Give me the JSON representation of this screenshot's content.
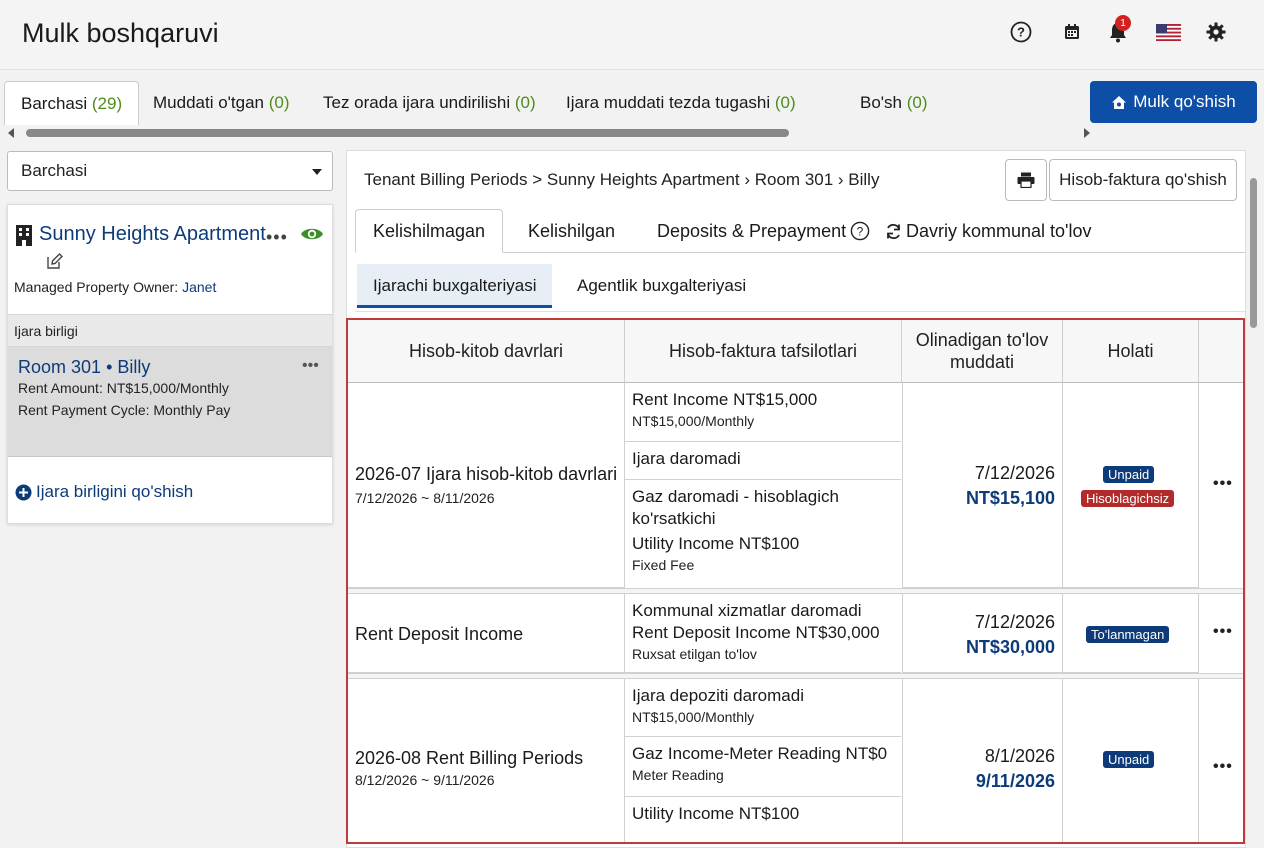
{
  "app": {
    "title": "Mulk boshqaruvi"
  },
  "header": {
    "notification_count": "1"
  },
  "top_tabs": [
    {
      "label": "Barchasi",
      "count": "(29)"
    },
    {
      "label": "Muddati o'tgan",
      "count": "(0)"
    },
    {
      "label": "Tez orada ijara undirilishi",
      "count": "(0)"
    },
    {
      "label": "Ijara muddati tezda tugashi",
      "count": "(0)"
    },
    {
      "label": "Bo'sh",
      "count": "(0)"
    }
  ],
  "add_property_button": "Mulk qo'shish",
  "filter": {
    "selected": "Barchasi"
  },
  "property": {
    "name": "Sunny Heights Apartment",
    "more": "•••",
    "owner_label": "Managed Property Owner: ",
    "owner_name": "Janet"
  },
  "rental_units": {
    "header": "Ijara birligi",
    "items": [
      {
        "room": "Room 301",
        "sep": " • ",
        "tenant": "Billy",
        "more": "•••",
        "rent_amount": "Rent Amount: NT$15,000/Monthly",
        "payment_cycle": "Rent Payment Cycle: Monthly Pay"
      }
    ],
    "add_label": "Ijara birligini qo'shish"
  },
  "breadcrumb": "Tenant Billing Periods >  Sunny Heights Apartment › Room 301 › Billy",
  "add_invoice_button": "Hisob-faktura qo'shish",
  "tabs": [
    {
      "label": "Kelishilmagan"
    },
    {
      "label": "Kelishilgan"
    },
    {
      "label": "Deposits & Prepayment"
    },
    {
      "label": "Davriy kommunal to'lov"
    }
  ],
  "subtabs": [
    {
      "label": "Ijarachi buxgalteriyasi"
    },
    {
      "label": "Agentlik buxgalteriyasi"
    }
  ],
  "table": {
    "headers": {
      "period": "Hisob-kitob davrlari",
      "details": "Hisob-faktura tafsilotlari",
      "due": "Olinadigan to'lov muddati",
      "status": "Holati"
    },
    "rows": [
      {
        "period_title": "2026-07 Ijara hisob-kitob davrlari",
        "period_range": "7/12/2026 ~ 8/11/2026",
        "details": [
          {
            "main": "Rent Income  NT$15,000",
            "sub": "NT$15,000/Monthly"
          },
          {
            "main": "Ijara daromadi",
            "sub": ""
          },
          {
            "main": "Gaz daromadi - hisoblagich ko'rsatkichi",
            "main2": "Utility Income  NT$100",
            "sub": "Fixed Fee"
          }
        ],
        "due_date": "7/12/2026",
        "due_amount": "NT$15,100",
        "status": [
          "Unpaid",
          "Hisoblagichsiz"
        ],
        "more": "•••"
      },
      {
        "period_title": "Rent Deposit Income",
        "period_range": "",
        "details": [
          {
            "main": "Kommunal xizmatlar daromadi",
            "main2": "Rent Deposit Income  NT$30,000",
            "sub": "Ruxsat etilgan to'lov"
          }
        ],
        "due_date": "7/12/2026",
        "due_amount": "NT$30,000",
        "status": [
          "To'lanmagan"
        ],
        "more": "•••"
      },
      {
        "period_title": "2026-08 Rent Billing Periods",
        "period_range": "8/12/2026 ~ 9/11/2026",
        "details": [
          {
            "main": "Ijara depoziti daromadi",
            "sub": "NT$15,000/Monthly"
          },
          {
            "main": "Gaz Income-Meter Reading  NT$0",
            "sub": "Meter Reading"
          },
          {
            "main": "Utility Income  NT$100",
            "sub": ""
          }
        ],
        "due_date": "8/1/2026",
        "due_amount": "9/11/2026",
        "status": [
          "Unpaid"
        ],
        "more": "•••"
      }
    ]
  },
  "colors": {
    "primary": "#0d4ea6",
    "link": "#0d3b79",
    "count_green": "#4e8d1a",
    "badge_red": "#b22a2a",
    "table_border": "#c0393b"
  },
  "icons": [
    "help-icon",
    "calendar-icon",
    "bell-icon",
    "flag-icon",
    "gear-icon",
    "home-icon",
    "building-icon",
    "eye-icon",
    "edit-icon",
    "plus-circle-icon",
    "print-icon",
    "info-icon",
    "refresh-icon"
  ]
}
